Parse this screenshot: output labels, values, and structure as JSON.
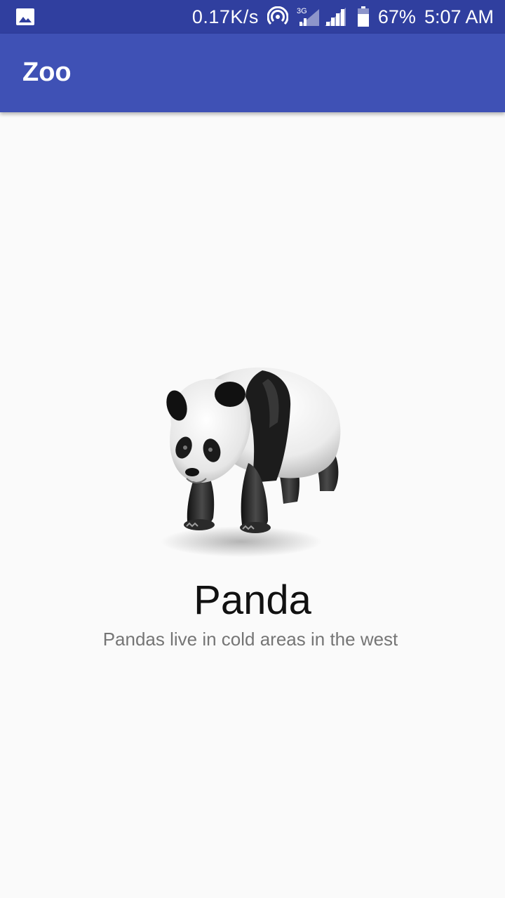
{
  "status_bar": {
    "notification_icon": "image-icon",
    "net_speed": "0.17K/s",
    "hotspot_icon": "hotspot-icon",
    "network_type": "3G",
    "signal_icon": "cell-signal-icon",
    "battery_icon": "battery-icon",
    "battery_percent": "67%",
    "time": "5:07 AM",
    "color": "#303f9f"
  },
  "app_bar": {
    "title": "Zoo",
    "color": "#3f51b5"
  },
  "animal": {
    "image_icon": "panda-image",
    "name": "Panda",
    "description": "Pandas live in cold areas in the west"
  }
}
